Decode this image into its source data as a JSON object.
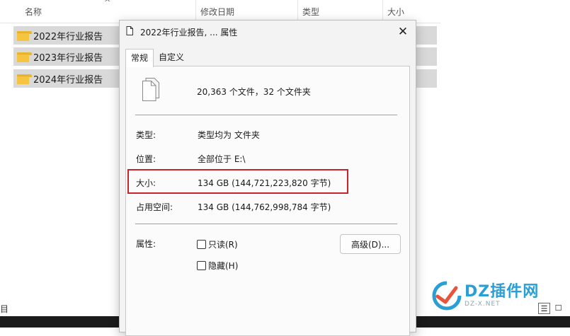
{
  "explorer": {
    "columns": {
      "name": "名称",
      "modified": "修改日期",
      "type": "类型",
      "size": "大小"
    },
    "files": [
      {
        "name": "2022年行业报告"
      },
      {
        "name": "2023年行业报告"
      },
      {
        "name": "2024年行业报告"
      }
    ],
    "status_text": "目",
    "watermark": {
      "title": "DZ插件网",
      "subtitle": "DZ-X.NET"
    }
  },
  "dialog": {
    "title": "2022年行业报告, ... 属性",
    "close_symbol": "✕",
    "tabs": [
      {
        "label": "常规",
        "active": true
      },
      {
        "label": "自定义",
        "active": false
      }
    ],
    "summary": "20,363 个文件，32 个文件夹",
    "properties": {
      "type_label": "类型:",
      "type_value": "类型均为 文件夹",
      "location_label": "位置:",
      "location_value": "全部位于 E:\\",
      "size_label": "大小:",
      "size_value": "134 GB (144,721,223,820 字节)",
      "disk_label": "占用空间:",
      "disk_value": "134 GB (144,762,998,784 字节)"
    },
    "attributes": {
      "label": "属性:",
      "readonly_label": "只读(R)",
      "readonly_checked": false,
      "hidden_label": "隐藏(H)",
      "hidden_checked": false,
      "advanced_button": "高级(D)..."
    },
    "highlight_color": "#c8232c"
  }
}
